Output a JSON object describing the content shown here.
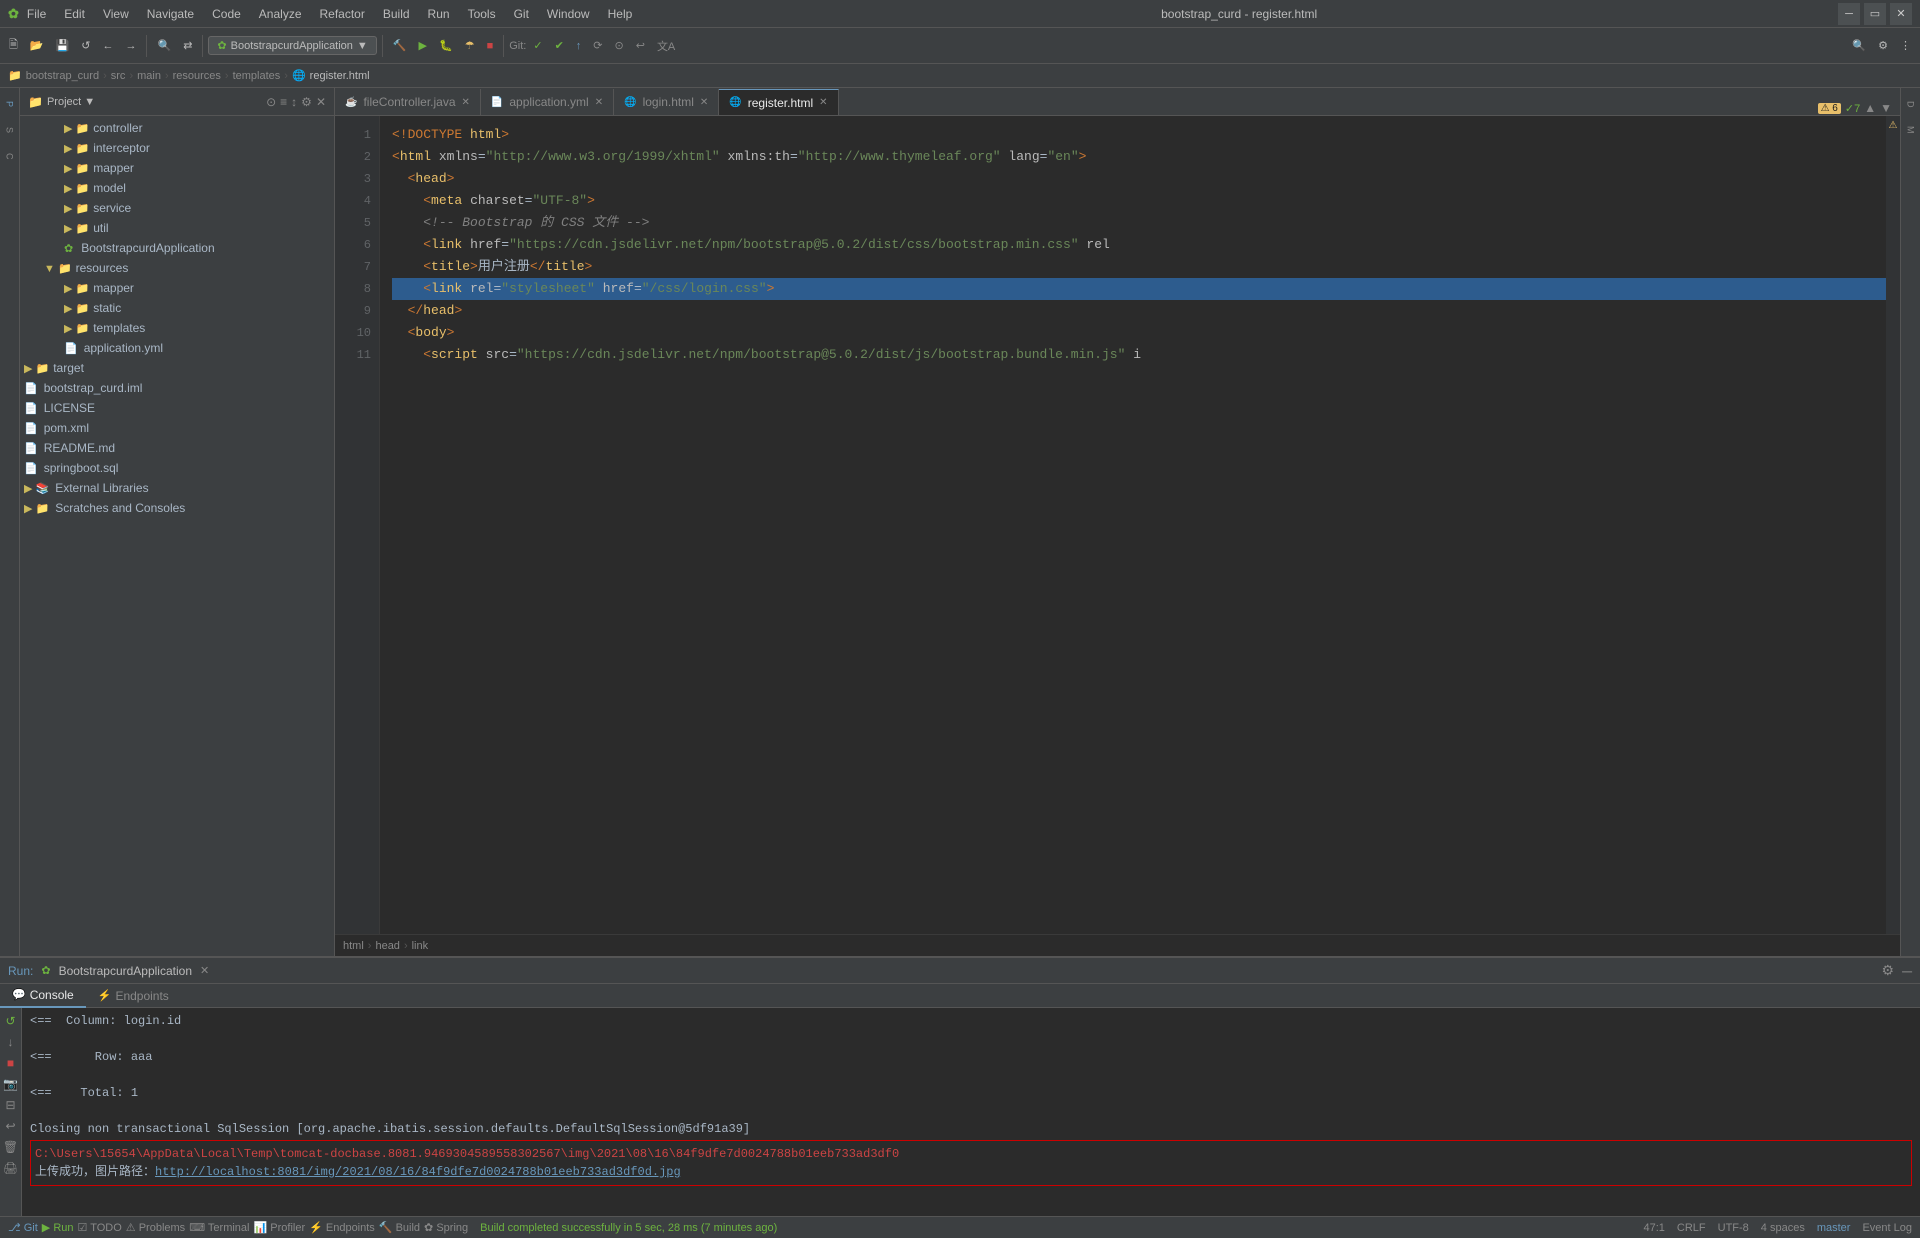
{
  "titlebar": {
    "title": "bootstrap_curd - register.html",
    "menu": [
      "File",
      "Edit",
      "View",
      "Navigate",
      "Code",
      "Analyze",
      "Refactor",
      "Build",
      "Run",
      "Tools",
      "Git",
      "Window",
      "Help"
    ]
  },
  "toolbar": {
    "project_dropdown": "BootstrapcurdApplication",
    "git_status": "Git:",
    "branch": "master"
  },
  "breadcrumb": {
    "path": [
      "bootstrap_curd",
      "src",
      "main",
      "resources",
      "templates",
      "register.html"
    ]
  },
  "tabs": [
    {
      "label": "fileController.java",
      "type": "java",
      "active": false
    },
    {
      "label": "application.yml",
      "type": "yaml",
      "active": false
    },
    {
      "label": "login.html",
      "type": "html",
      "active": false
    },
    {
      "label": "register.html",
      "type": "html",
      "active": true
    }
  ],
  "code": {
    "lines": [
      {
        "num": 1,
        "content": "<!DOCTYPE html>"
      },
      {
        "num": 2,
        "content": "<html xmlns=\"http://www.w3.org/1999/xhtml\" xmlns:th=\"http://www.thymeleaf.org\" lang=\"en\">"
      },
      {
        "num": 3,
        "content": "  <head>"
      },
      {
        "num": 4,
        "content": "    <meta charset=\"UTF-8\">"
      },
      {
        "num": 5,
        "content": "    <!-- Bootstrap 的 CSS 文件 -->"
      },
      {
        "num": 6,
        "content": "    <link href=\"https://cdn.jsdelivr.net/npm/bootstrap@5.0.2/dist/css/bootstrap.min.css\" rel"
      },
      {
        "num": 7,
        "content": "    <title>用户注册</title>"
      },
      {
        "num": 8,
        "content": "    <link rel=\"stylesheet\" href=\"/css/login.css\">",
        "highlighted": true
      },
      {
        "num": 9,
        "content": "  </head>"
      },
      {
        "num": 10,
        "content": "  <body>"
      },
      {
        "num": 11,
        "content": "    <script src=\"https://cdn.jsdelivr.net/npm/bootstrap@5.0.2/dist/js/bootstrap.bundle.min.js\" i"
      }
    ],
    "breadcrumb": [
      "html",
      "head",
      "link"
    ]
  },
  "project_tree": {
    "items": [
      {
        "indent": 2,
        "type": "folder",
        "label": "controller",
        "expanded": false
      },
      {
        "indent": 2,
        "type": "folder",
        "label": "interceptor",
        "expanded": false
      },
      {
        "indent": 2,
        "type": "folder",
        "label": "mapper",
        "expanded": false
      },
      {
        "indent": 2,
        "type": "folder",
        "label": "model",
        "expanded": false
      },
      {
        "indent": 2,
        "type": "folder",
        "label": "service",
        "expanded": false
      },
      {
        "indent": 2,
        "type": "folder",
        "label": "util",
        "expanded": false
      },
      {
        "indent": 2,
        "type": "app-class",
        "label": "BootstrapcurdApplication",
        "expanded": false
      },
      {
        "indent": 1,
        "type": "folder",
        "label": "resources",
        "expanded": true
      },
      {
        "indent": 2,
        "type": "folder",
        "label": "mapper",
        "expanded": false
      },
      {
        "indent": 2,
        "type": "folder",
        "label": "static",
        "expanded": false
      },
      {
        "indent": 2,
        "type": "folder",
        "label": "templates",
        "expanded": false
      },
      {
        "indent": 2,
        "type": "yaml",
        "label": "application.yml",
        "expanded": false
      },
      {
        "indent": 0,
        "type": "folder",
        "label": "target",
        "expanded": false
      },
      {
        "indent": 0,
        "type": "iml",
        "label": "bootstrap_curd.iml",
        "expanded": false
      },
      {
        "indent": 0,
        "type": "file",
        "label": "LICENSE",
        "expanded": false
      },
      {
        "indent": 0,
        "type": "xml",
        "label": "pom.xml",
        "expanded": false
      },
      {
        "indent": 0,
        "type": "md",
        "label": "README.md",
        "expanded": false
      },
      {
        "indent": 0,
        "type": "sql",
        "label": "springboot.sql",
        "expanded": false
      },
      {
        "indent": 0,
        "type": "folder",
        "label": "External Libraries",
        "expanded": false
      },
      {
        "indent": 0,
        "type": "folder",
        "label": "Scratches and Consoles",
        "expanded": false
      }
    ]
  },
  "bottom_panel": {
    "run_label": "Run:",
    "app_name": "BootstrapcurdApplication",
    "tabs": [
      {
        "label": "Console",
        "active": true
      },
      {
        "label": "Endpoints",
        "active": false
      }
    ],
    "console_lines": [
      {
        "text": "<==  Column: login.id",
        "type": "normal"
      },
      {
        "text": "<==      Row: aaa",
        "type": "normal"
      },
      {
        "text": "<==    Total: 1",
        "type": "normal"
      },
      {
        "text": "Closing non transactional SqlSession [org.apache.ibatis.session.defaults.DefaultSqlSession@5df91a39]",
        "type": "normal"
      },
      {
        "text": "C:\\Users\\15654\\AppData\\Local\\Temp\\tomcat-docbase.8081.9469304589558302567\\img\\2021\\08\\16\\84f9dfe7d0024788b01eeb733ad3df0",
        "type": "error_box"
      },
      {
        "text": "上传成功，图片路径：",
        "type": "link_line",
        "link": "http://localhost:8081/img/2021/08/16/84f9dfe7d0024788b01eeb733ad3df0d.jpg"
      }
    ]
  },
  "status_bar": {
    "git": "Git",
    "run": "Run",
    "todo": "TODO",
    "problems": "Problems",
    "terminal": "Terminal",
    "profiler": "Profiler",
    "endpoints": "Endpoints",
    "build": "Build",
    "spring": "Spring",
    "line_col": "47:1",
    "crlf": "CRLF",
    "encoding": "UTF-8",
    "indent": "4 spaces",
    "branch": "master",
    "event_log": "Event Log",
    "build_msg": "Build completed successfully in 5 sec, 28 ms (7 minutes ago)"
  }
}
